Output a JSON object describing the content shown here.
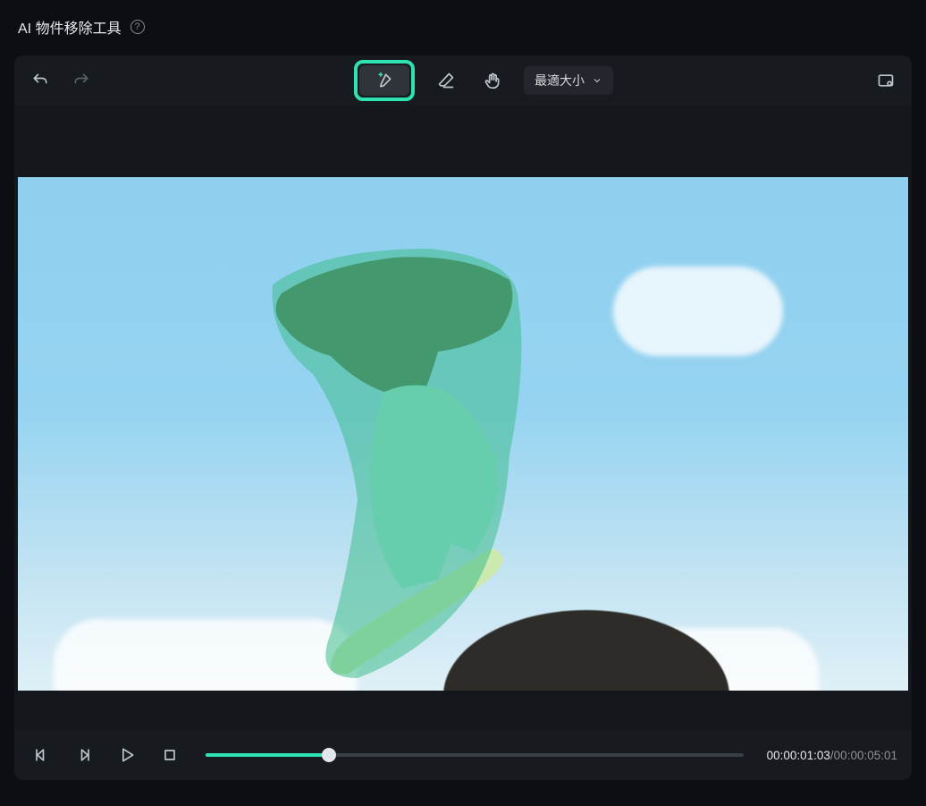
{
  "header": {
    "title": "AI 物件移除工具",
    "help_label": "?"
  },
  "toolbar": {
    "zoom_label": "最適大小",
    "icons": {
      "undo": "undo-icon",
      "redo": "redo-icon",
      "brush": "brush-plus-icon",
      "eraser": "eraser-icon",
      "hand": "hand-icon",
      "compare": "compare-icon"
    }
  },
  "playback": {
    "current_time": "00:00:01:03",
    "total_time": "00:00:05:01",
    "progress_percent": 23,
    "icons": {
      "prev_frame": "prev-frame-icon",
      "next_frame": "next-frame-icon",
      "play": "play-icon",
      "stop": "stop-icon"
    }
  },
  "colors": {
    "accent": "#2fe2b2",
    "panel": "#14171c",
    "toolbar": "#171b20"
  }
}
